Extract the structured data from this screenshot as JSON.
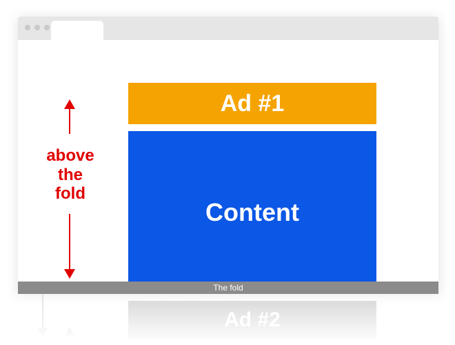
{
  "browser": {
    "ad1_label": "Ad #1",
    "content_label": "Content"
  },
  "fold": {
    "label": "The fold"
  },
  "annotation": {
    "above_line1": "above",
    "above_line2": "the",
    "above_line3": "fold"
  },
  "below": {
    "ad2_label": "Ad #2"
  },
  "colors": {
    "ad": "#f5a300",
    "content": "#0b57e6",
    "annotation": "#e10000",
    "fold_bar": "#8b8b8b"
  }
}
